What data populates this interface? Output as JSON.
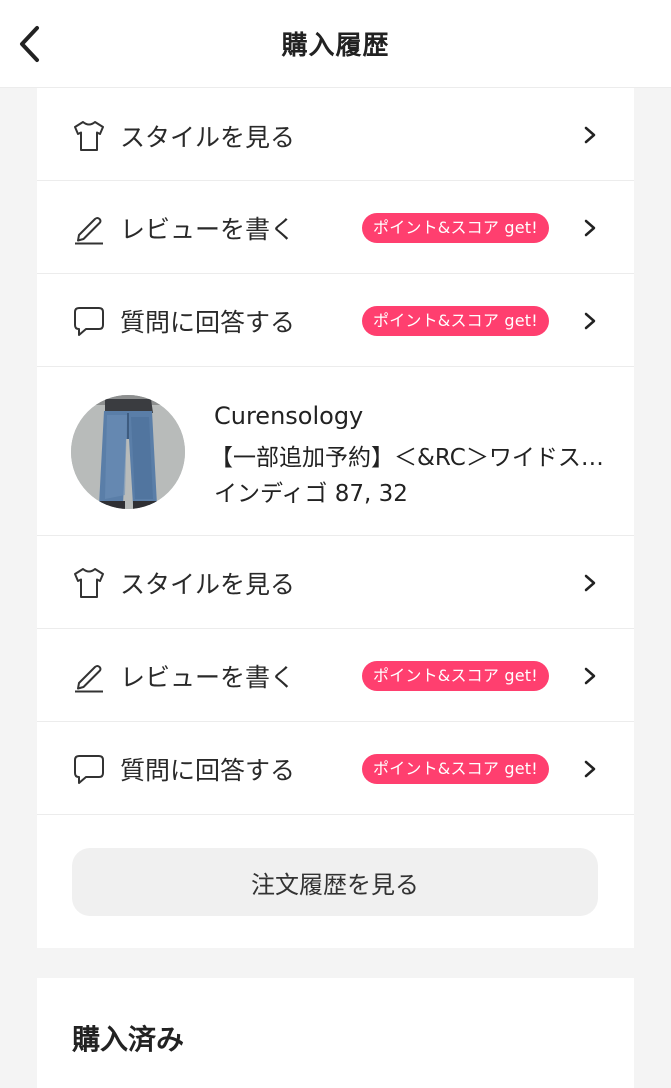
{
  "header": {
    "title": "購入履歴"
  },
  "item1": {
    "style_label": "スタイルを見る",
    "review_label": "レビューを書く",
    "review_badge": "ポイント&スコア get!",
    "question_label": "質問に回答する",
    "question_badge": "ポイント&スコア get!"
  },
  "product": {
    "brand": "Curensology",
    "name": "【一部追加予約】＜&RC＞ワイドストレートデニム",
    "variant": "インディゴ 87, 32"
  },
  "item2": {
    "style_label": "スタイルを見る",
    "review_label": "レビューを書く",
    "review_badge": "ポイント&スコア get!",
    "question_label": "質問に回答する",
    "question_badge": "ポイント&スコア get!"
  },
  "order_history_button": "注文履歴を見る",
  "purchased_section": {
    "title": "購入済み"
  },
  "colors": {
    "badge": "#ff3f6f",
    "background": "#f4f4f4",
    "card": "#ffffff"
  }
}
